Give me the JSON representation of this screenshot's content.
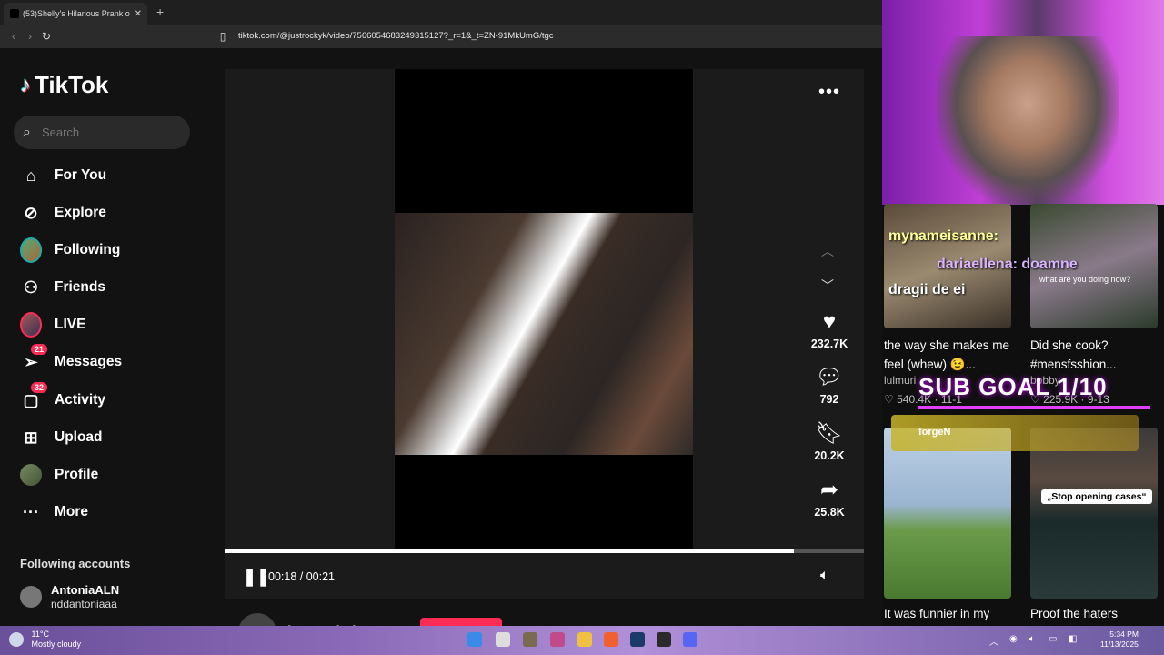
{
  "browser": {
    "tab_title": "(53)Shelly's Hilarious Prank o",
    "new_tab": "+",
    "url": "tiktok.com/@justrockyk/video/7566054683249315127?_r=1&_t=ZN-91MkUmG/tgc"
  },
  "sidebar": {
    "logo": "TikTok",
    "search_placeholder": "Search",
    "items": [
      {
        "label": "For You"
      },
      {
        "label": "Explore"
      },
      {
        "label": "Following"
      },
      {
        "label": "Friends"
      },
      {
        "label": "LIVE"
      },
      {
        "label": "Messages",
        "badge": "21"
      },
      {
        "label": "Activity",
        "badge": "32"
      },
      {
        "label": "Upload"
      },
      {
        "label": "Profile"
      },
      {
        "label": "More"
      }
    ],
    "following_title": "Following accounts",
    "account": {
      "name": "AntoniaALN",
      "handle": "nddantoniaaa"
    }
  },
  "player": {
    "likes": "232.7K",
    "comments": "792",
    "saves": "20.2K",
    "shares": "25.8K",
    "time": "00:18 / 00:21",
    "progress": 0.89,
    "author": "justrockyk"
  },
  "overlay": {
    "chat": [
      "mynameisanne:",
      "dariaellena: doamne",
      "dragii de ei"
    ],
    "thumb_top_text": "what are you doing now?",
    "thumbs": [
      {
        "caption": "the way she makes me feel (whew) 😉...",
        "meta": "lulmuri",
        "likes": "540.4K",
        "date": "11-1"
      },
      {
        "caption": "Did she cook? #mensfsshion...",
        "meta": "bobby",
        "likes": "225.9K",
        "date": "9-13"
      },
      {
        "caption": "It was funnier in my",
        "meta": "",
        "likes": "",
        "date": ""
      },
      {
        "caption": "Proof the haters",
        "meta": "",
        "likes": "",
        "date": ""
      }
    ],
    "subgoal": "SUB GOAL 1/10",
    "alert_name": "forgeN",
    "speech": "„Stop opening cases“"
  },
  "taskbar": {
    "temp": "11°C",
    "weather": "Mostly cloudy",
    "time": "5:34 PM",
    "date": "11/13/2025"
  },
  "colors": {
    "accent": "#fe2c55",
    "bg": "#121212",
    "overlay_purple": "#c03fd6"
  }
}
